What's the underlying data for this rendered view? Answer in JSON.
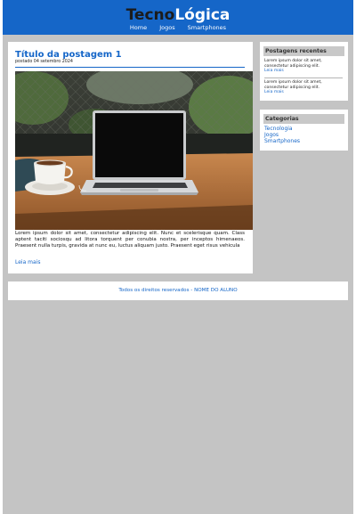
{
  "brand": {
    "part1": "Tecno",
    "part2": "Lógica"
  },
  "nav": {
    "items": [
      {
        "label": "Home"
      },
      {
        "label": "Jogos"
      },
      {
        "label": "Smartphones"
      }
    ]
  },
  "post": {
    "title": "Título da postagem 1",
    "date": "postado 04 setembro 2024",
    "body": "Lorem ipsum dolor sit amet, consectetur adipiscing elit. Nunc et scelerisque quam. Class aptent taciti sociosqu ad litora torquent per conubia nostra, per inceptos himenaeos. Praesent nulla turpis, gravida at nunc eu, luctus aliquam justo. Praesent eget risus vehicula",
    "more_label": "Leia mais"
  },
  "sidebar": {
    "recent": {
      "title": "Postagens recentes",
      "items": [
        {
          "text": "Lorem ipsum dolor sit amet, consectetur adipiscing elit.",
          "link": "Leia mais"
        },
        {
          "text": "Lorem ipsum dolor sit amet, consectetur adipiscing elit.",
          "link": "Leia mais"
        }
      ]
    },
    "categories": {
      "title": "Categorias",
      "items": [
        {
          "label": "Tecnologia"
        },
        {
          "label": "Jogos"
        },
        {
          "label": "Smartphones"
        }
      ]
    }
  },
  "footer": {
    "text": "Todos os direitos reservados - NOME DO ALUNO"
  },
  "colors": {
    "brand_blue": "#1566c8",
    "page_bg": "#c4c4c4",
    "logo_dark": "#1b1b1b"
  }
}
